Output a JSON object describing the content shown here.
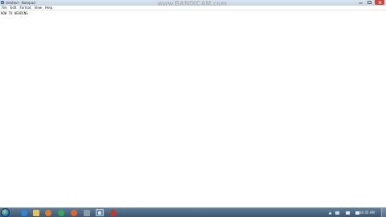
{
  "window": {
    "title": "Untitled - Notepad"
  },
  "recorder": {
    "watermark": "www.BANDICAM.com"
  },
  "menu": {
    "items": [
      "File",
      "Edit",
      "Format",
      "View",
      "Help"
    ]
  },
  "editor": {
    "content": "HOW TO HEADING"
  },
  "taskbar": {
    "clock": "10:35 AM",
    "pinned_icons": [
      "ie-icon",
      "explorer-icon",
      "media-player-icon",
      "chrome-icon",
      "firefox-icon",
      "app-icon",
      "notepad-icon",
      "bandicam-icon"
    ],
    "colors": {
      "ie": "#2e86d6",
      "explorer": "#e8c25a",
      "media": "#e07a2a",
      "chrome": "#3aa757",
      "firefox": "#e4632c",
      "app": "#8e9aa6",
      "notepad": "#cfe3f5",
      "bandicam": "#c0392b"
    }
  }
}
